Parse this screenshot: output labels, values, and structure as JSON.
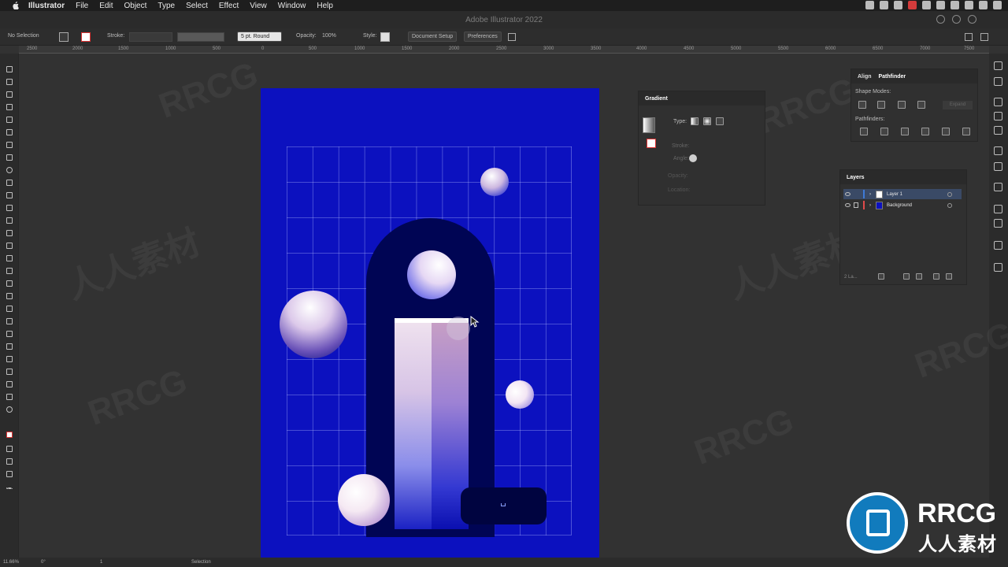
{
  "menubar": {
    "app": "Illustrator",
    "items": [
      "File",
      "Edit",
      "Object",
      "Type",
      "Select",
      "Effect",
      "View",
      "Window",
      "Help"
    ]
  },
  "window": {
    "title": "Adobe Illustrator 2022"
  },
  "control_bar": {
    "selection": "No Selection",
    "stroke_label": "Stroke:",
    "brush": "5 pt. Round",
    "opacity_label": "Opacity:",
    "opacity_value": "100%",
    "style_label": "Style:",
    "document_setup": "Document Setup",
    "preferences": "Preferences"
  },
  "ruler": {
    "ticks": [
      "2500",
      "2000",
      "1500",
      "1000",
      "500",
      "0",
      "500",
      "1000",
      "1500",
      "2000",
      "2500",
      "3000",
      "3500",
      "4000",
      "4500",
      "5000",
      "5500",
      "6000",
      "6500",
      "7000",
      "7500"
    ]
  },
  "gradient_panel": {
    "title": "Gradient",
    "type_label": "Type:",
    "stroke_label": "Stroke:",
    "angle_label": "Angle:",
    "opacity_label": "Opacity:",
    "location_label": "Location:"
  },
  "align_panel": {
    "tab_align": "Align",
    "tab_pathfinder": "Pathfinder",
    "shape_modes": "Shape Modes:",
    "expand": "Expand",
    "pathfinders": "Pathfinders:"
  },
  "layers_panel": {
    "title": "Layers",
    "layers": [
      {
        "name": "Layer 1",
        "color": "#3e7bd6"
      },
      {
        "name": "Background",
        "color": "#e04a4a"
      }
    ],
    "count": "2 La..."
  },
  "status_bar": {
    "zoom": "11.66%",
    "rotation": "0°",
    "artboard": "1",
    "tool": "Selection"
  },
  "colors": {
    "artboard": "#0c11bf",
    "arch": "#000554",
    "ui_dark": "#2b2b2b"
  },
  "watermark": {
    "latin": "RRCG",
    "cjk": "人人素材"
  }
}
